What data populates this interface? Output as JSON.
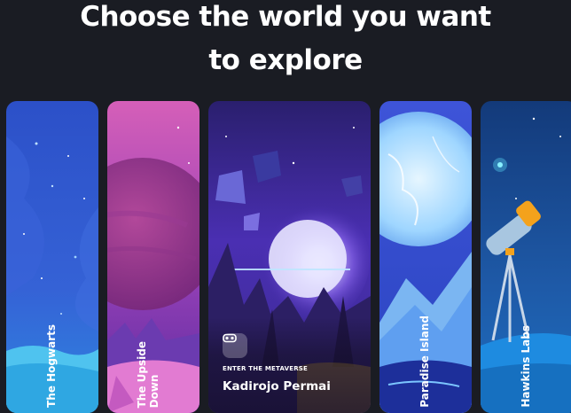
{
  "heading": {
    "line1": "Choose the world you want",
    "line2": "to explore"
  },
  "cards": [
    {
      "label": "The Hogwarts",
      "active": false
    },
    {
      "label": "The Upside\nDown",
      "active": false
    },
    {
      "eyebrow": "ENTER THE METAVERSE",
      "title": "Kadirojo Permai",
      "icon": "vr-headset-icon",
      "active": true
    },
    {
      "label": "Paradise Island",
      "active": false
    },
    {
      "label": "Hawkins Labs",
      "active": false
    }
  ],
  "colors": {
    "background": "#1a1c23",
    "text": "#ffffff"
  }
}
